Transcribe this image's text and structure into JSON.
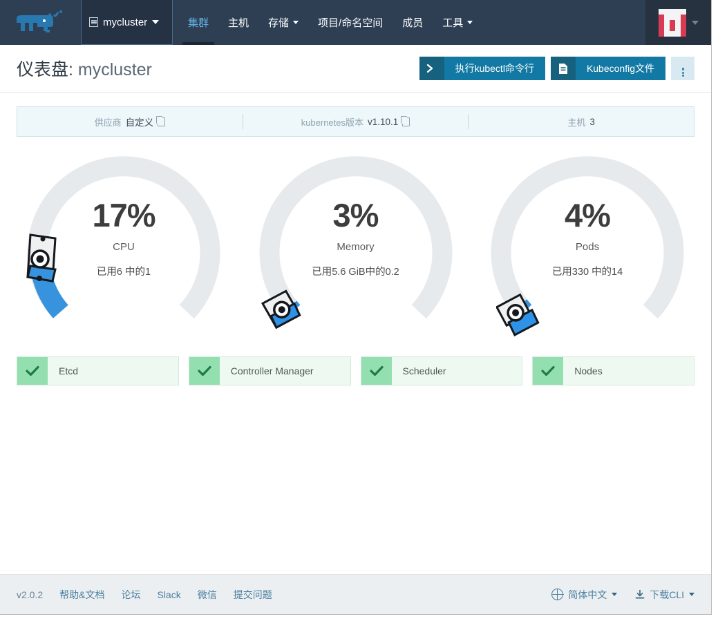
{
  "header": {
    "logo_name": "rancher-cow-logo",
    "cluster_picker": {
      "label": "mycluster",
      "icon": "grid-icon"
    },
    "nav_items": [
      {
        "label": "集群",
        "active": true,
        "caret": false
      },
      {
        "label": "主机",
        "active": false,
        "caret": false
      },
      {
        "label": "存储",
        "active": false,
        "caret": true
      },
      {
        "label": "项目/命名空间",
        "active": false,
        "caret": false
      },
      {
        "label": "成员",
        "active": false,
        "caret": false
      },
      {
        "label": "工具",
        "active": false,
        "caret": true
      }
    ],
    "avatar_name": "user-avatar"
  },
  "title": {
    "prefix": "仪表盘",
    "separator": ":",
    "name": "mycluster"
  },
  "actions": {
    "kubectl_button": {
      "label": "执行kubectl命令行",
      "icon": "terminal-prompt-icon"
    },
    "kubeconfig_button": {
      "label": "Kubeconfig文件",
      "icon": "file-document-icon"
    },
    "kebab": "more-actions"
  },
  "infobar": {
    "cells": [
      {
        "key": "供应商",
        "value": "自定义",
        "copy": true
      },
      {
        "key": "kubernetes版本",
        "value": "v1.10.1",
        "copy": true
      },
      {
        "key": "主机",
        "value": "3",
        "copy": false
      }
    ]
  },
  "gauges": [
    {
      "name": "cpu",
      "percent_label": "17%",
      "percent": 17,
      "label": "CPU",
      "sub": "已用6 中的1",
      "arc_color": "#3793dd",
      "track_color": "#e7eaec"
    },
    {
      "name": "memory",
      "percent_label": "3%",
      "percent": 3,
      "label": "Memory",
      "sub": "已用5.6 GiB中的0.2",
      "arc_color": "#3793dd",
      "track_color": "#e7eaec"
    },
    {
      "name": "pods",
      "percent_label": "4%",
      "percent": 4,
      "label": "Pods",
      "sub": "已用330 中的14",
      "arc_color": "#3793dd",
      "track_color": "#e7eaec"
    }
  ],
  "status_cards": [
    {
      "label": "Etcd",
      "state": "healthy"
    },
    {
      "label": "Controller Manager",
      "state": "healthy"
    },
    {
      "label": "Scheduler",
      "state": "healthy"
    },
    {
      "label": "Nodes",
      "state": "healthy"
    }
  ],
  "footer": {
    "version": "v2.0.2",
    "links": [
      "帮助&文档",
      "论坛",
      "Slack",
      "微信",
      "提交问题"
    ],
    "language": {
      "label": "简体中文",
      "icon": "globe-icon"
    },
    "download_cli": {
      "label": "下载CLI",
      "icon": "download-icon"
    }
  },
  "colors": {
    "header_bg": "#2e3f54",
    "accent_blue": "#1279a4",
    "gauge_blue": "#3793dd",
    "healthy_green": "#93dfb0",
    "avatar_red": "#d93a54"
  }
}
